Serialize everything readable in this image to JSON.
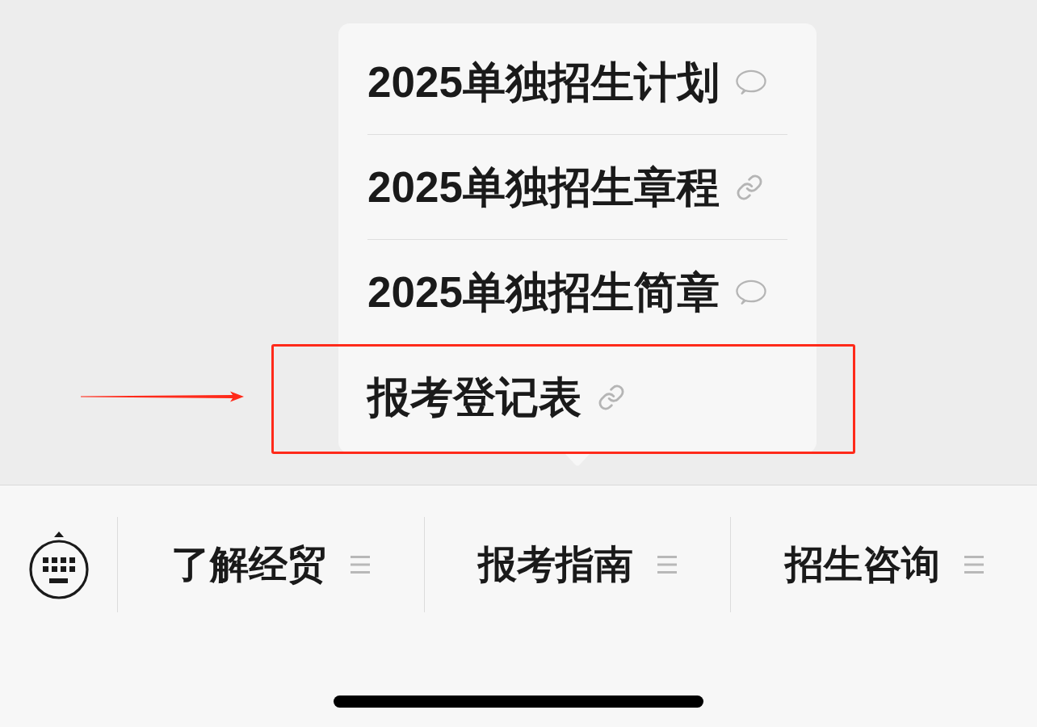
{
  "menu_bar": {
    "items": [
      {
        "label": "了解经贸"
      },
      {
        "label": "报考指南",
        "submenu": [
          {
            "label": "2025单独招生计划",
            "kind": "message",
            "highlighted": false
          },
          {
            "label": "2025单独招生章程",
            "kind": "link",
            "highlighted": false
          },
          {
            "label": "2025单独招生简章",
            "kind": "message",
            "highlighted": false
          },
          {
            "label": "报考登记表",
            "kind": "link",
            "highlighted": true
          }
        ]
      },
      {
        "label": "招生咨询"
      }
    ]
  }
}
